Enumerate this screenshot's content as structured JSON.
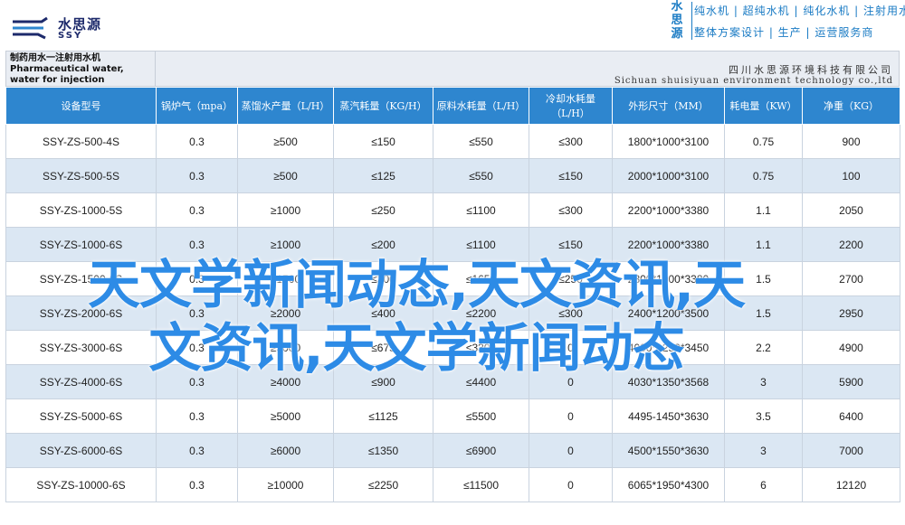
{
  "logo": {
    "name_cn": "水思源",
    "name_en": "SSY"
  },
  "brand": {
    "badge": "水思源",
    "line1": "纯水机 | 超纯水机 | 纯化水机 | 注射用水设备",
    "line2": "整体方案设计 | 生产 | 运营服务商"
  },
  "sheet": {
    "title_cn": "制药用水一注射用水机",
    "title_en": "Pharmaceutical water, water for injection",
    "company_cn": "四川水思源环境科技有限公司",
    "company_en": "Sichuan shuisiyuan environment technology co.,ltd"
  },
  "columns": [
    "设备型号",
    "锅炉气（mpa）",
    "蒸馏水产量（L/H）",
    "蒸汽耗量（KG/H）",
    "原料水耗量（L/H）",
    "冷却水耗量（L/H）",
    "外形尺寸（MM）",
    "耗电量（KW）",
    "净重（KG）"
  ],
  "rows": [
    [
      "SSY-ZS-500-4S",
      "0.3",
      "≥500",
      "≤150",
      "≤550",
      "≤300",
      "1800*1000*3100",
      "0.75",
      "900"
    ],
    [
      "SSY-ZS-500-5S",
      "0.3",
      "≥500",
      "≤125",
      "≤550",
      "≤150",
      "2000*1000*3100",
      "0.75",
      "100"
    ],
    [
      "SSY-ZS-1000-5S",
      "0.3",
      "≥1000",
      "≤250",
      "≤1100",
      "≤300",
      "2200*1000*3380",
      "1.1",
      "2050"
    ],
    [
      "SSY-ZS-1000-6S",
      "0.3",
      "≥1000",
      "≤200",
      "≤1100",
      "≤150",
      "2200*1000*3380",
      "1.1",
      "2200"
    ],
    [
      "SSY-ZS-1500-6S",
      "0.3",
      "≥1500",
      "≤300",
      "≤1650",
      "≤250",
      "2300*1000*3380",
      "1.5",
      "2700"
    ],
    [
      "SSY-ZS-2000-6S",
      "0.3",
      "≥2000",
      "≤400",
      "≤2200",
      "≤300",
      "2400*1200*3500",
      "1.5",
      "2950"
    ],
    [
      "SSY-ZS-3000-6S",
      "0.3",
      "≥3000",
      "≤675",
      "≤3300",
      "0",
      "4000*1250*3450",
      "2.2",
      "4900"
    ],
    [
      "SSY-ZS-4000-6S",
      "0.3",
      "≥4000",
      "≤900",
      "≤4400",
      "0",
      "4030*1350*3568",
      "3",
      "5900"
    ],
    [
      "SSY-ZS-5000-6S",
      "0.3",
      "≥5000",
      "≤1125",
      "≤5500",
      "0",
      "4495-1450*3630",
      "3.5",
      "6400"
    ],
    [
      "SSY-ZS-6000-6S",
      "0.3",
      "≥6000",
      "≤1350",
      "≤6900",
      "0",
      "4500*1550*3630",
      "3",
      "7000"
    ],
    [
      "SSY-ZS-10000-6S",
      "0.3",
      "≥10000",
      "≤2250",
      "≤11500",
      "0",
      "6065*1950*4300",
      "6",
      "12120"
    ]
  ],
  "overlay": {
    "line1": "天文学新闻动态,天文资讯,天",
    "line2": "文资讯,天文学新闻动态"
  },
  "colors": {
    "header_blue": "#2e86cf",
    "row_alt": "#dbe7f3",
    "overlay_text": "#2d8be6",
    "brand_text": "#1a7bc4",
    "logo_text": "#1d2a6b"
  }
}
